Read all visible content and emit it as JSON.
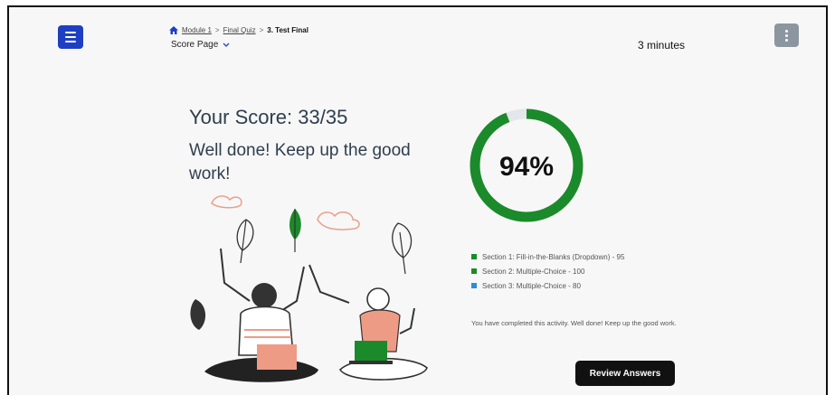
{
  "breadcrumb": {
    "items": [
      {
        "label": "Module 1"
      },
      {
        "label": "Final Quiz"
      }
    ],
    "current": "3. Test Final",
    "separator": ">"
  },
  "page_select": {
    "label": "Score Page"
  },
  "timer": {
    "text": "3 minutes"
  },
  "score": {
    "title": "Your Score: 33/35",
    "percent_text": "94%",
    "percent": 94
  },
  "message": "Well done! Keep up the good work!",
  "sections": [
    {
      "label": "Section 1: Fill-in-the-Blanks (Dropdown) - 95",
      "color": "#1b8a2a"
    },
    {
      "label": "Section 2: Multiple-Choice - 100",
      "color": "#1b8a2a"
    },
    {
      "label": "Section 3: Multiple-Choice - 80",
      "color": "#2a8fd8"
    }
  ],
  "completion_text": "You have completed this activity. Well done! Keep up the good work.",
  "review_button": {
    "label": "Review Answers"
  },
  "colors": {
    "accent": "#1f3fc2",
    "success": "#1b8a2a",
    "ring_track": "#e3e6ea",
    "illustration_skin": "#ee9b86"
  },
  "icons": {
    "menu": "hamburger-icon",
    "more": "kebab-icon",
    "home": "home-icon",
    "dropdown": "chevron-down-icon"
  }
}
